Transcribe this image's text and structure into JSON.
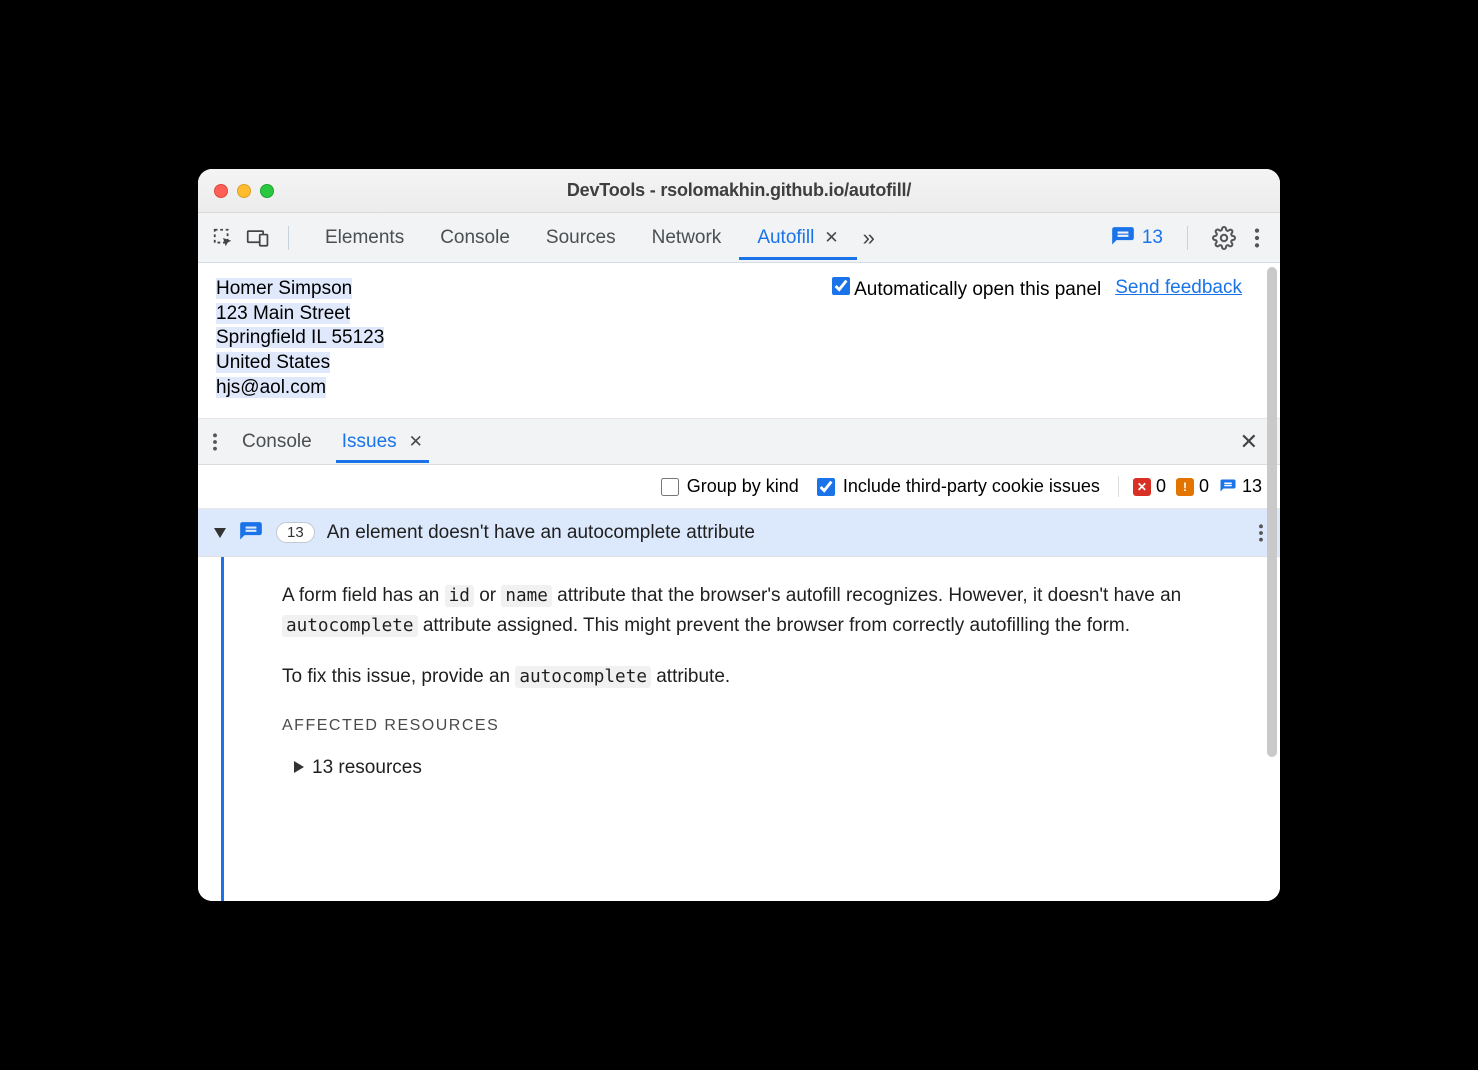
{
  "window": {
    "title": "DevTools - rsolomakhin.github.io/autofill/"
  },
  "toolbar": {
    "tabs": [
      "Elements",
      "Console",
      "Sources",
      "Network",
      "Autofill"
    ],
    "active_tab": "Autofill",
    "issues_badge_count": "13"
  },
  "autofill_panel": {
    "profile_lines": [
      "Homer Simpson",
      "123 Main Street",
      "Springfield IL 55123",
      "United States",
      "hjs@aol.com"
    ],
    "auto_open_checkbox_label": "Automatically open this panel",
    "auto_open_checked": true,
    "feedback_link": "Send feedback"
  },
  "drawer": {
    "tabs": [
      "Console",
      "Issues"
    ],
    "active_tab": "Issues"
  },
  "filters": {
    "group_by_kind_label": "Group by kind",
    "group_by_kind_checked": false,
    "third_party_label": "Include third-party cookie issues",
    "third_party_checked": true,
    "severity": {
      "errors": "0",
      "warnings": "0",
      "info": "13"
    }
  },
  "issue": {
    "count": "13",
    "title": "An element doesn't have an autocomplete attribute",
    "body_part1_pre": "A form field has an ",
    "body_code1": "id",
    "body_part1_mid": " or ",
    "body_code2": "name",
    "body_part1_post": " attribute that the browser's autofill recognizes. However, it doesn't have an ",
    "body_code3": "autocomplete",
    "body_part1_tail": " attribute assigned. This might prevent the browser from correctly autofilling the form.",
    "body_part2_pre": "To fix this issue, provide an ",
    "body_code4": "autocomplete",
    "body_part2_post": " attribute.",
    "affected_heading": "AFFECTED RESOURCES",
    "resources_label": "13 resources"
  }
}
